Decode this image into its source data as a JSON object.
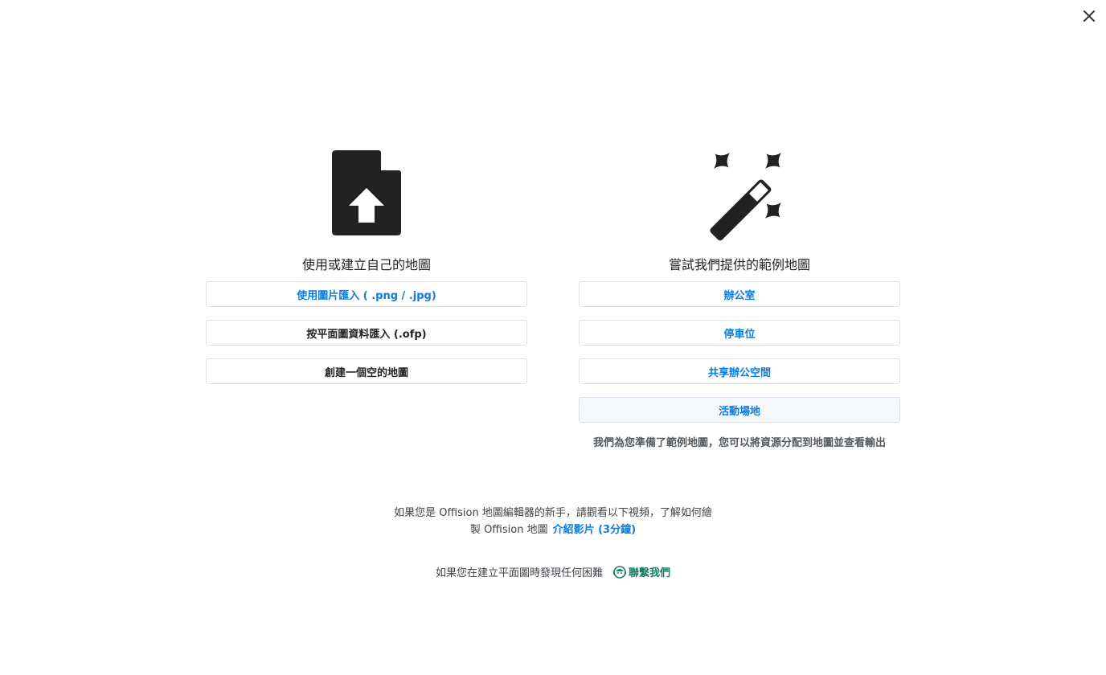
{
  "dialog": {
    "close_icon": "close-icon"
  },
  "left": {
    "icon": "file-upload-icon",
    "title": "使用或建立自己的地圖",
    "options": [
      {
        "label": "使用圖片匯入 ( .png / .jpg)",
        "color": "#0a7ee0"
      },
      {
        "label": "按平面圖資料匯入 (.ofp)",
        "color": "#212529"
      },
      {
        "label": "創建一個空的地圖",
        "color": "#212529"
      }
    ]
  },
  "right": {
    "icon": "magic-wand-icon",
    "title": "嘗試我們提供的範例地圖",
    "options": [
      {
        "label": "辦公室"
      },
      {
        "label": "停車位"
      },
      {
        "label": "共享辦公空間"
      },
      {
        "label": "活動場地"
      }
    ],
    "note": "我們為您準備了範例地圖，您可以將資源分配到地圖並查看輸出"
  },
  "footer": {
    "video_text": "如果您是 Offision 地圖編輯器的新手，請觀看以下視頻，了解如何繪製 Offision 地圖",
    "video_link": "介紹影片 (3分鐘)",
    "contact_text": "如果您在建立平面圖時發現任何困難",
    "contact_link": "聯繫我們",
    "contact_icon": "support-agent-icon"
  },
  "colors": {
    "accent": "#0a7ee0",
    "contact": "#198068",
    "icon": "#222222"
  }
}
